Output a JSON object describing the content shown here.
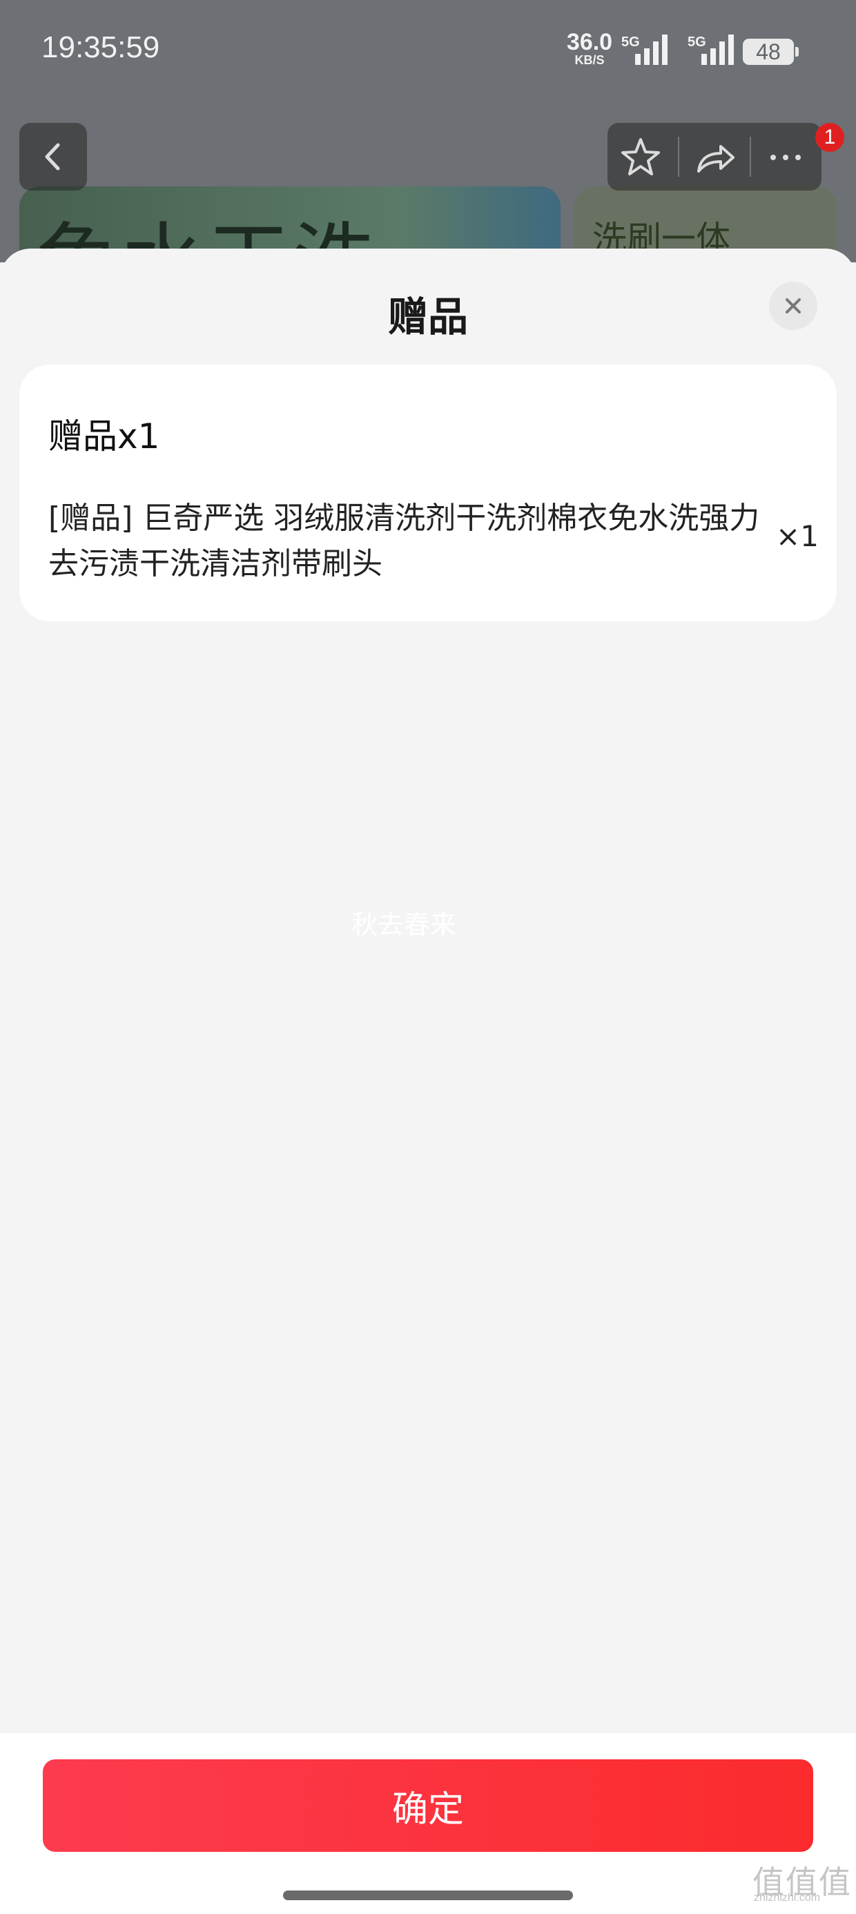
{
  "status_bar": {
    "time": "19:35:59",
    "net_speed_value": "36.0",
    "net_speed_unit": "KB/S",
    "sim1_type": "5G",
    "sim2_type": "5G",
    "battery_level": "48"
  },
  "background_page": {
    "hero_text": "免水干洗",
    "side_banner_text": "洗刷一体",
    "notification_count": "1"
  },
  "sheet": {
    "title": "赠品",
    "card_heading": "赠品x1",
    "items": [
      {
        "name": "[赠品] 巨奇严选 羽绒服清洗剂干洗剂棉衣免水洗强力去污渍干洗清洁剂带刷头",
        "quantity": "×1"
      }
    ],
    "watermark": "秋去春来",
    "confirm_label": "确定"
  },
  "site_logo": {
    "chars": "值值值",
    "url": "zhizhizhi.com"
  },
  "colors": {
    "accent_red": "#fb2b2d",
    "badge_red": "#e02020",
    "sheet_bg": "#f4f4f4"
  }
}
